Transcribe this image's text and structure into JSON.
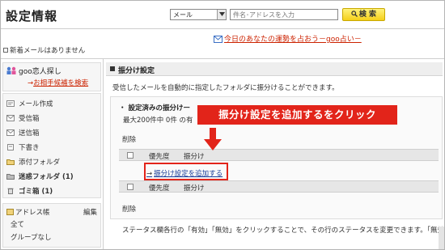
{
  "header": {
    "title": "設定情報",
    "search_select_value": "メール",
    "search_placeholder": "件名･アドレスを入力",
    "search_button": "検 索"
  },
  "subbar": {
    "mail_status": "新着メールはありません",
    "fortune_link": "今日のあなたの運勢を占おう－goo占い－"
  },
  "sidebar": {
    "goo_title": "goo恋人探し",
    "goo_link": "お相手候補を検索",
    "folders": [
      {
        "label": "メール作成",
        "icon": "compose-icon"
      },
      {
        "label": "受信箱",
        "icon": "inbox-icon"
      },
      {
        "label": "送信箱",
        "icon": "outbox-icon"
      },
      {
        "label": "下書き",
        "icon": "draft-icon"
      },
      {
        "label": "添付フォルダ",
        "icon": "attachment-folder-icon"
      },
      {
        "label": "迷惑フォルダ (1)",
        "icon": "spam-folder-icon"
      },
      {
        "label": "ゴミ箱 (1)",
        "icon": "trash-icon"
      }
    ],
    "address_book": "アドレス帳",
    "address_edit": "編集",
    "address_rows": [
      "全て",
      "グループなし"
    ]
  },
  "main": {
    "section_title": "振分け設定",
    "description": "受信したメールを自動的に指定したフォルダに振分けることができます。",
    "saved_title": "・ 設定済みの振分けー",
    "count_text": "最大200件中 0件 の有",
    "delete_label": "削除",
    "col_priority": "優先度",
    "col_sort": "振分け",
    "add_link": "振分け設定を追加する",
    "status_note": "ステータス欄各行の「有効」「無効」をクリックすることで、その行のステータスを変更できます。「無効」に"
  },
  "annotation": {
    "callout": "振分け設定を追加するをクリック"
  },
  "colors": {
    "accent_red": "#e2241a",
    "link_red": "#cc2200",
    "link_blue": "#1a3d99",
    "search_yellow": "#f5cf1a"
  }
}
